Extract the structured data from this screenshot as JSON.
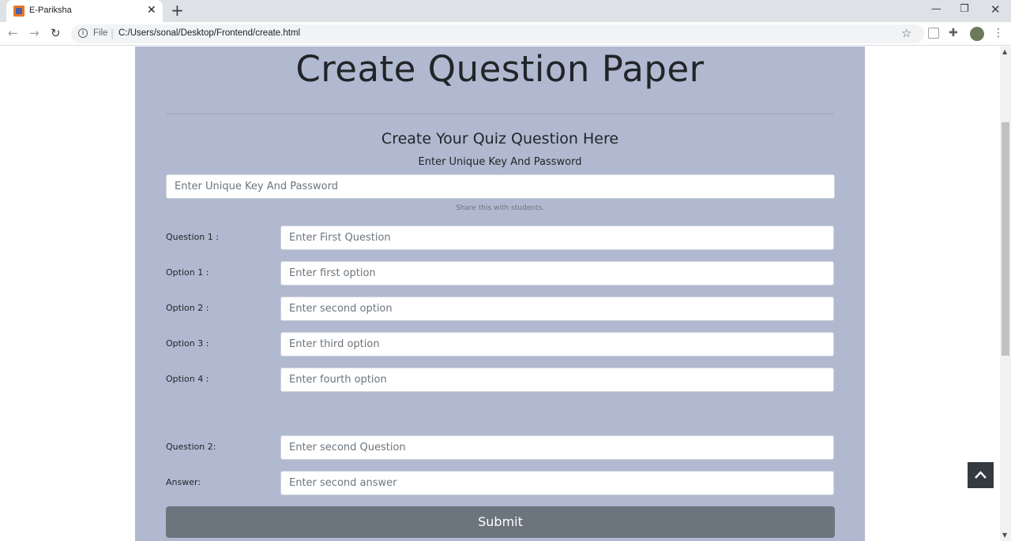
{
  "browser": {
    "tab_title": "E-Pariksha",
    "tab_close": "✕",
    "new_tab": "+",
    "win_min": "—",
    "win_max": "❐",
    "win_close": "✕",
    "nav_back": "←",
    "nav_forward": "→",
    "nav_reload": "↻",
    "url_scheme": "File",
    "url": "C:/Users/sonal/Desktop/Frontend/create.html",
    "star": "☆",
    "menu": "⋮"
  },
  "page": {
    "title": "Create Question Paper",
    "subtitle": "Create Your Quiz Question Here",
    "key_label": "Enter Unique Key And Password",
    "key_placeholder": "Enter Unique Key And Password",
    "key_help": "Share this with students.",
    "question1": {
      "label": "Question 1 :",
      "placeholder": "Enter First Question",
      "options": [
        {
          "label": "Option 1 :",
          "placeholder": "Enter first option"
        },
        {
          "label": "Option 2 :",
          "placeholder": "Enter second option"
        },
        {
          "label": "Option 3 :",
          "placeholder": "Enter third option"
        },
        {
          "label": "Option 4 :",
          "placeholder": "Enter fourth option"
        }
      ]
    },
    "question2": {
      "label": "Question 2:",
      "placeholder": "Enter second Question",
      "answer_label": "Answer:",
      "answer_placeholder": "Enter second answer"
    },
    "submit_label": "Submit"
  },
  "colors": {
    "panel_bg": "#b1b9d0",
    "submit_bg": "#6c757d",
    "back_to_top_bg": "#343a40"
  },
  "icons": {
    "info": "info-icon",
    "back_to_top": "chevron-up-icon"
  }
}
